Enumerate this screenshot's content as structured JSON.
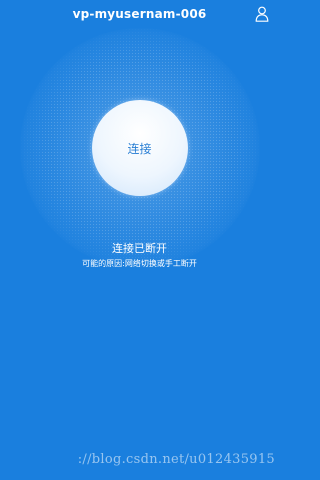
{
  "header": {
    "title": "vp-myusernam-006",
    "user_icon": "user-icon"
  },
  "connect": {
    "label": "连接"
  },
  "status": {
    "title": "连接已断开",
    "reason": "可能的原因:网络切换或手工断开"
  },
  "watermark": {
    "text": "://blog.csdn.net/u012435915"
  },
  "colors": {
    "background": "#1a7fde",
    "button_text": "#2a7fd4",
    "text": "#ffffff"
  }
}
